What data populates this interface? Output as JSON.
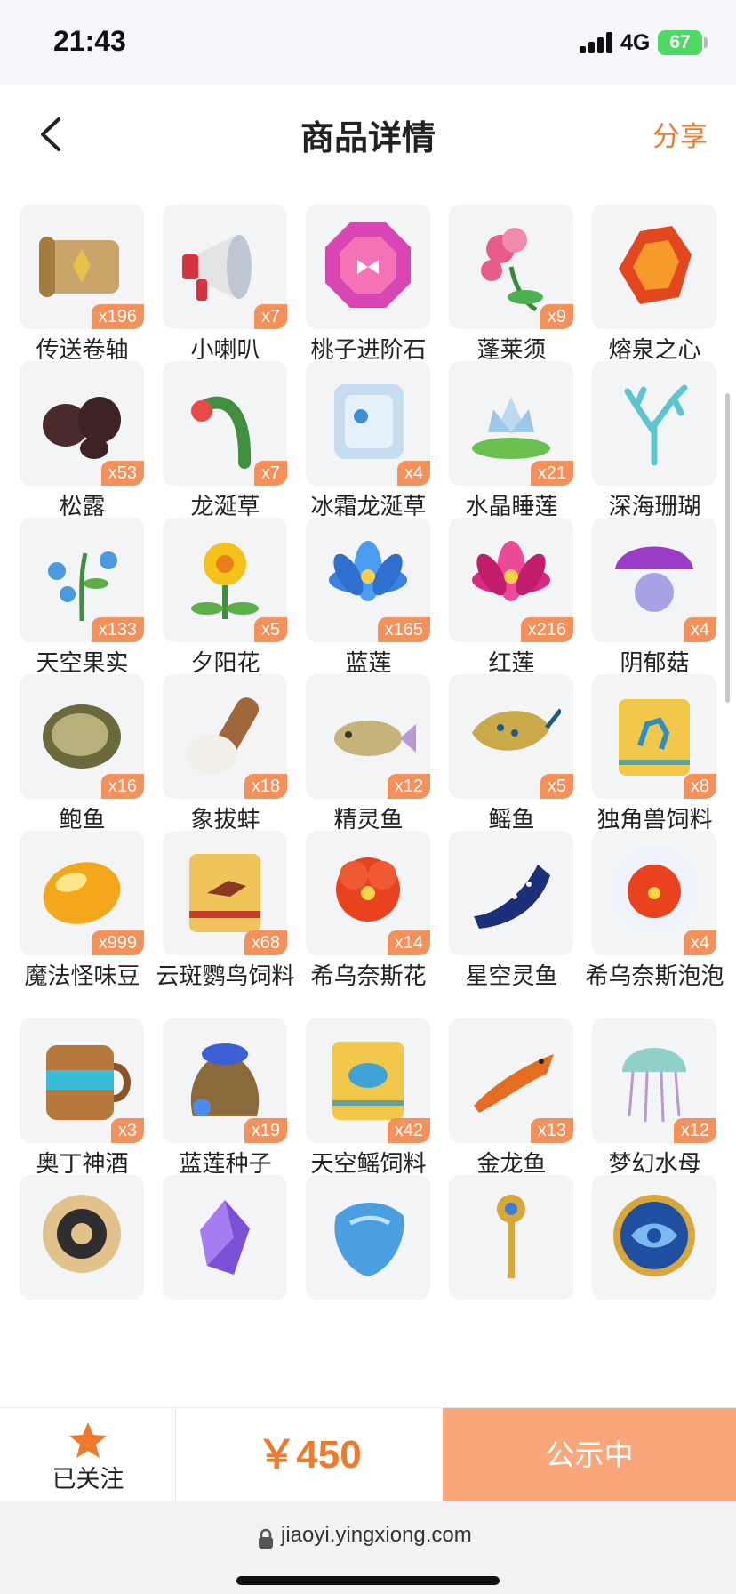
{
  "status": {
    "time": "21:43",
    "network": "4G",
    "battery": "67"
  },
  "header": {
    "title": "商品详情",
    "share_label": "分享"
  },
  "items": [
    {
      "name": "传送卷轴",
      "count": "x196",
      "icon": "scroll-icon"
    },
    {
      "name": "小喇叭",
      "count": "x7",
      "icon": "megaphone-icon"
    },
    {
      "name": "桃子进阶石",
      "count": "",
      "icon": "gem-icon"
    },
    {
      "name": "蓬莱须",
      "count": "x9",
      "icon": "flower-icon"
    },
    {
      "name": "熔泉之心",
      "count": "",
      "icon": "lava-crystal-icon"
    },
    {
      "name": "松露",
      "count": "x53",
      "icon": "truffle-icon"
    },
    {
      "name": "龙涎草",
      "count": "x7",
      "icon": "herb-icon"
    },
    {
      "name": "冰霜龙涎草",
      "count": "x4",
      "icon": "ice-cube-icon"
    },
    {
      "name": "水晶睡莲",
      "count": "x21",
      "icon": "water-lily-icon"
    },
    {
      "name": "深海珊瑚",
      "count": "",
      "icon": "coral-icon"
    },
    {
      "name": "天空果实",
      "count": "x133",
      "icon": "berry-plant-icon"
    },
    {
      "name": "夕阳花",
      "count": "x5",
      "icon": "sunset-flower-icon"
    },
    {
      "name": "蓝莲",
      "count": "x165",
      "icon": "blue-lotus-icon"
    },
    {
      "name": "红莲",
      "count": "x216",
      "icon": "red-lotus-icon"
    },
    {
      "name": "阴郁菇",
      "count": "x4",
      "icon": "mushroom-icon"
    },
    {
      "name": "鲍鱼",
      "count": "x16",
      "icon": "abalone-icon"
    },
    {
      "name": "象拔蚌",
      "count": "x18",
      "icon": "geoduck-icon"
    },
    {
      "name": "精灵鱼",
      "count": "x12",
      "icon": "spirit-fish-icon"
    },
    {
      "name": "鳐鱼",
      "count": "x5",
      "icon": "stingray-icon"
    },
    {
      "name": "独角兽饲料",
      "count": "x8",
      "icon": "feed-bag-icon"
    },
    {
      "name": "魔法怪味豆",
      "count": "x999",
      "icon": "golden-bean-icon"
    },
    {
      "name": "云斑鹦鸟饲料",
      "count": "x68",
      "icon": "bird-feed-icon"
    },
    {
      "name": "希乌奈斯花",
      "count": "x14",
      "icon": "hibiscus-icon"
    },
    {
      "name": "星空灵鱼",
      "count": "",
      "icon": "starry-fish-icon"
    },
    {
      "name": "希乌奈斯泡泡",
      "count": "x4",
      "icon": "hibiscus-bubble-icon"
    },
    {
      "name": "奥丁神酒",
      "count": "x3",
      "icon": "mead-barrel-icon"
    },
    {
      "name": "蓝莲种子",
      "count": "x19",
      "icon": "seed-sack-icon"
    },
    {
      "name": "天空鳐饲料",
      "count": "x42",
      "icon": "ray-feed-icon"
    },
    {
      "name": "金龙鱼",
      "count": "x13",
      "icon": "arowana-icon"
    },
    {
      "name": "梦幻水母",
      "count": "x12",
      "icon": "jellyfish-icon"
    },
    {
      "name": "",
      "count": "",
      "icon": "sun-vortex-icon"
    },
    {
      "name": "",
      "count": "",
      "icon": "purple-crystal-icon"
    },
    {
      "name": "",
      "count": "",
      "icon": "blue-stone-icon"
    },
    {
      "name": "",
      "count": "",
      "icon": "golden-key-icon"
    },
    {
      "name": "",
      "count": "",
      "icon": "eye-coin-icon"
    }
  ],
  "footer": {
    "follow_label": "已关注",
    "price": "￥450",
    "buy_label": "公示中"
  },
  "browser": {
    "url": "jiaoyi.yingxiong.com"
  },
  "colors": {
    "accent": "#f07a2a",
    "badge": "#f5905a",
    "buy_button": "#f9a77a",
    "tile": "#f3f4f6"
  }
}
